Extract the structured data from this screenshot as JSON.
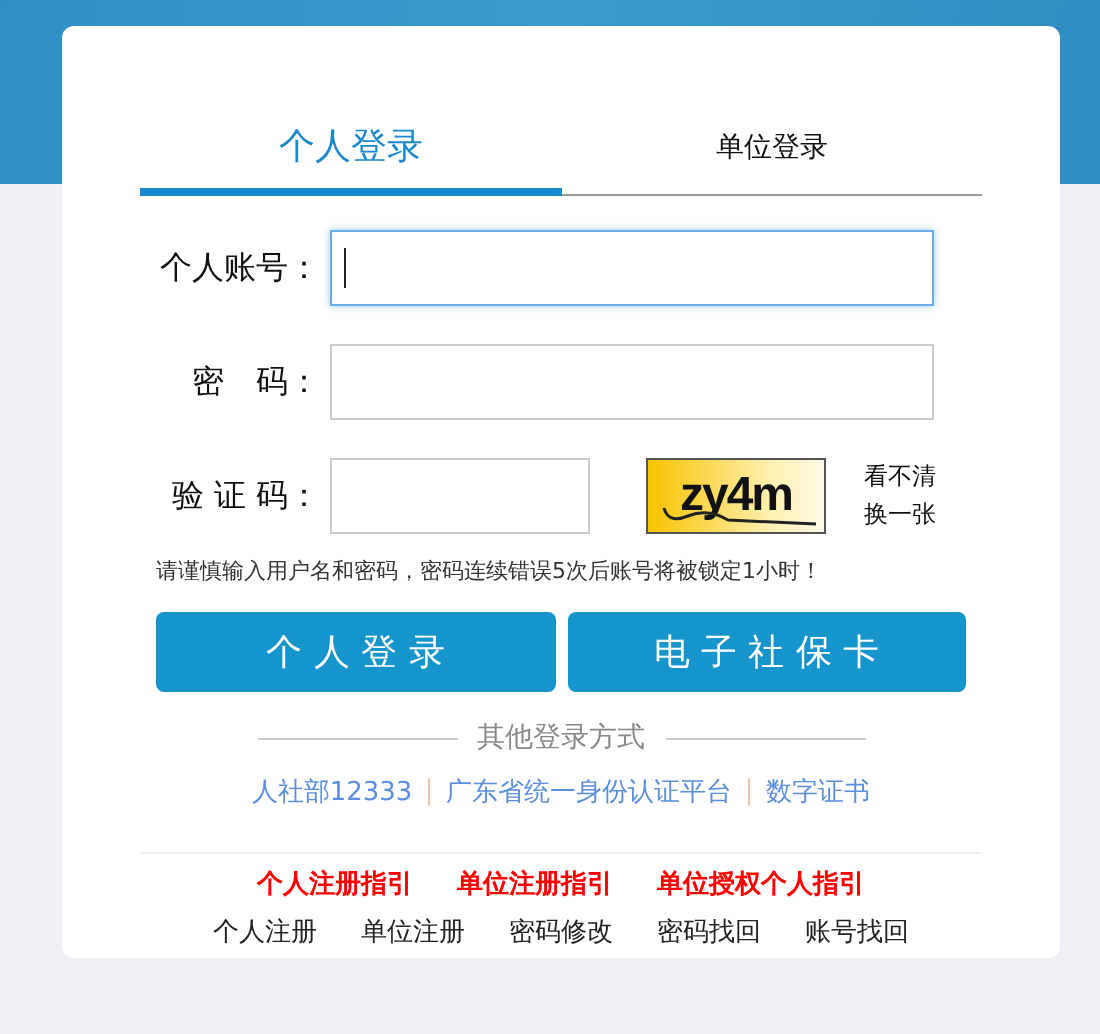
{
  "tabs": [
    {
      "label": "个人登录",
      "selected": true
    },
    {
      "label": "单位登录",
      "selected": false
    }
  ],
  "fields": [
    {
      "label": "个人账号：",
      "kind": "text",
      "focused": true
    },
    {
      "label": "密　码：",
      "kind": "password",
      "focused": false
    },
    {
      "label": "验 证 码：",
      "kind": "captcha",
      "focused": false
    }
  ],
  "captcha": {
    "text": "zy4m",
    "refresh": [
      "看不清",
      "换一张"
    ]
  },
  "hint": "请谨慎输入用户名和密码，密码连续错误5次后账号将被锁定1小时！",
  "buttons": [
    "个 人 登 录",
    "电 子 社 保 卡"
  ],
  "other_login": {
    "title": "其他登录方式",
    "links": [
      "人社部12333",
      "广东省统一身份认证平台",
      "数字证书"
    ]
  },
  "guide_links": [
    "个人注册指引",
    "单位注册指引",
    "单位授权个人指引"
  ],
  "footer_links": [
    "个人注册",
    "单位注册",
    "密码修改",
    "密码找回",
    "账号找回"
  ]
}
